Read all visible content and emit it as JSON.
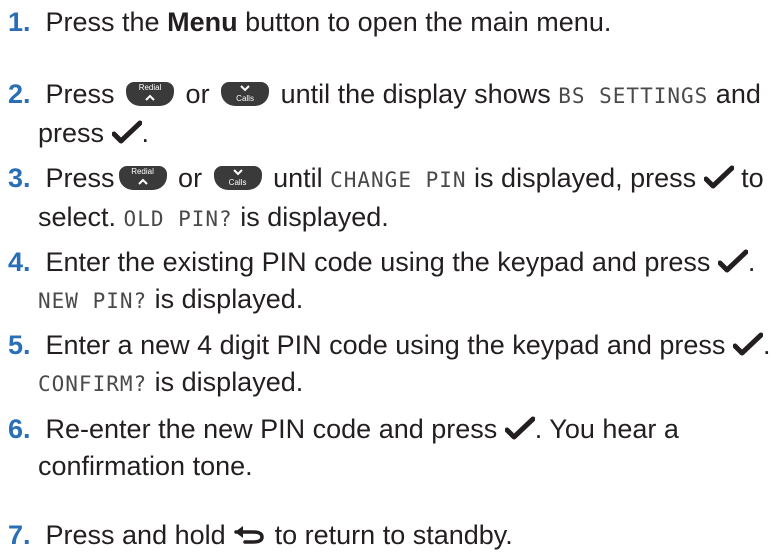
{
  "steps": [
    {
      "num": "1.",
      "pre": "Press the ",
      "bold": "Menu",
      "post": " button to open the main menu."
    },
    {
      "num": "2.",
      "a": "Press ",
      "b": " or ",
      "c": " until the display shows ",
      "lcd": "BS SETTINGS",
      "d": " and",
      "e": "press ",
      "f": "."
    },
    {
      "num": "3.",
      "a": "Press",
      "b": " or ",
      "c": " until ",
      "lcd": "CHANGE PIN",
      "d": " is displayed, press ",
      "e": " to",
      "f": "select. ",
      "lcd2": "OLD PIN?",
      "g": " is displayed."
    },
    {
      "num": "4.",
      "a": "Enter the existing PIN code using the keypad and press ",
      "b": ".",
      "lcd": "NEW PIN?",
      "c": " is displayed."
    },
    {
      "num": "5.",
      "a": "Enter a new 4 digit PIN code using the keypad and press ",
      "b": ".",
      "lcd": "CONFIRM?",
      "c": " is displayed."
    },
    {
      "num": "6.",
      "a": "Re-enter the new PIN code and press ",
      "b": ". You hear a",
      "c": "confirmation tone."
    },
    {
      "num": "7.",
      "a": "Press and hold ",
      "b": " to return to standby."
    }
  ],
  "keys": {
    "redial": "Redial",
    "calls": "Calls"
  },
  "icons": {
    "ok": "checkmark-icon",
    "back": "back-arrow-icon",
    "up": "chevron-up-icon",
    "down": "chevron-down-icon"
  },
  "colors": {
    "step_number": "#2a6fb6",
    "text": "#231f20",
    "key": "#3a3a3a"
  }
}
